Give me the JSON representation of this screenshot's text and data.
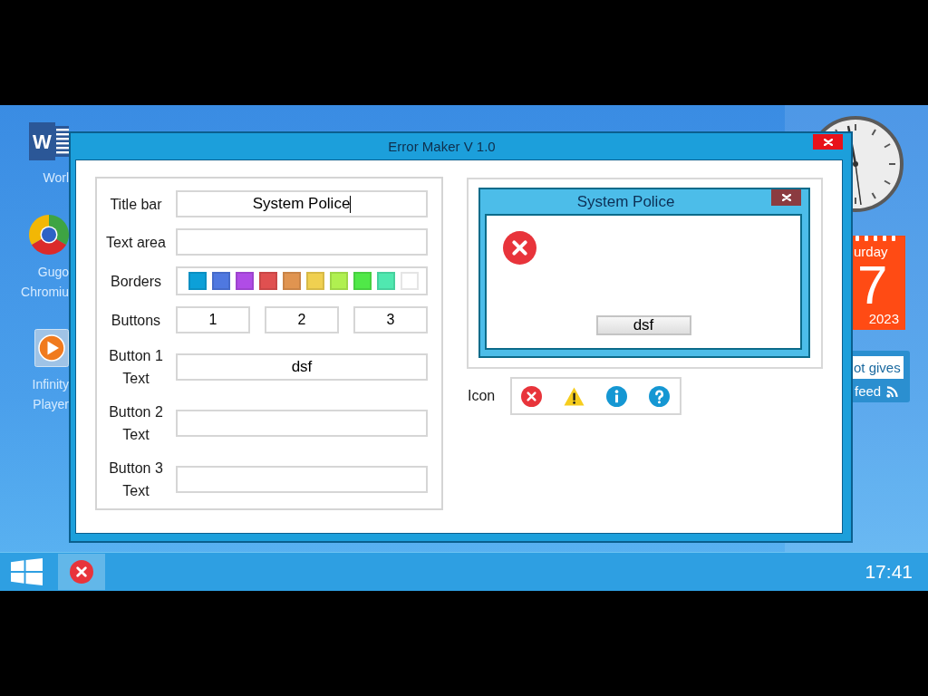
{
  "desktop_icons": [
    {
      "kind": "document",
      "glyph": "W",
      "label": "Worl"
    },
    {
      "kind": "tricolor",
      "label": "Gugo Chromiu"
    },
    {
      "kind": "player",
      "label": "Infinity Player"
    }
  ],
  "widgets": {
    "calendar": {
      "day_name": "urday",
      "day": "7",
      "year": "2023"
    },
    "feed": {
      "headline": "ot gives",
      "label": "feed"
    }
  },
  "window": {
    "title": "Error Maker V 1.0",
    "form": {
      "rows": [
        {
          "kind": "text",
          "label": "Title bar",
          "value": "System Police",
          "focused": true
        },
        {
          "kind": "text",
          "label": "Text area",
          "focused": false
        },
        {
          "kind": "colors",
          "label": "Borders",
          "swatches": [
            {
              "color": "#0ca0d8"
            },
            {
              "color": "#4f78e0"
            },
            {
              "color": "#b04ce6"
            },
            {
              "color": "#e05050"
            },
            {
              "color": "#e09450"
            },
            {
              "color": "#f0d050"
            },
            {
              "color": "#b0f050"
            },
            {
              "color": "#50e848"
            },
            {
              "color": "#50e8b0"
            },
            {
              "color": "#ffffff"
            }
          ]
        },
        {
          "kind": "buttons",
          "label": "Buttons",
          "buttons": [
            "1",
            "2",
            "3"
          ]
        },
        {
          "kind": "text",
          "label": "Button 1 Text",
          "value": "dsf",
          "focused": false
        },
        {
          "kind": "text",
          "label": "Button 2 Text",
          "focused": false
        },
        {
          "kind": "text",
          "label": "Button 3 Text",
          "focused": false
        }
      ]
    },
    "preview": {
      "title": "System Police",
      "icon": {
        "kind": "error"
      },
      "buttons": [
        "dsf"
      ]
    },
    "icon_picker": {
      "label": "Icon",
      "icons": [
        {
          "kind": "error"
        },
        {
          "kind": "warning"
        },
        {
          "kind": "info"
        },
        {
          "kind": "question"
        }
      ]
    }
  },
  "taskbar": {
    "apps": [
      {
        "kind": "error",
        "active": true
      }
    ],
    "clock": "17:41"
  }
}
